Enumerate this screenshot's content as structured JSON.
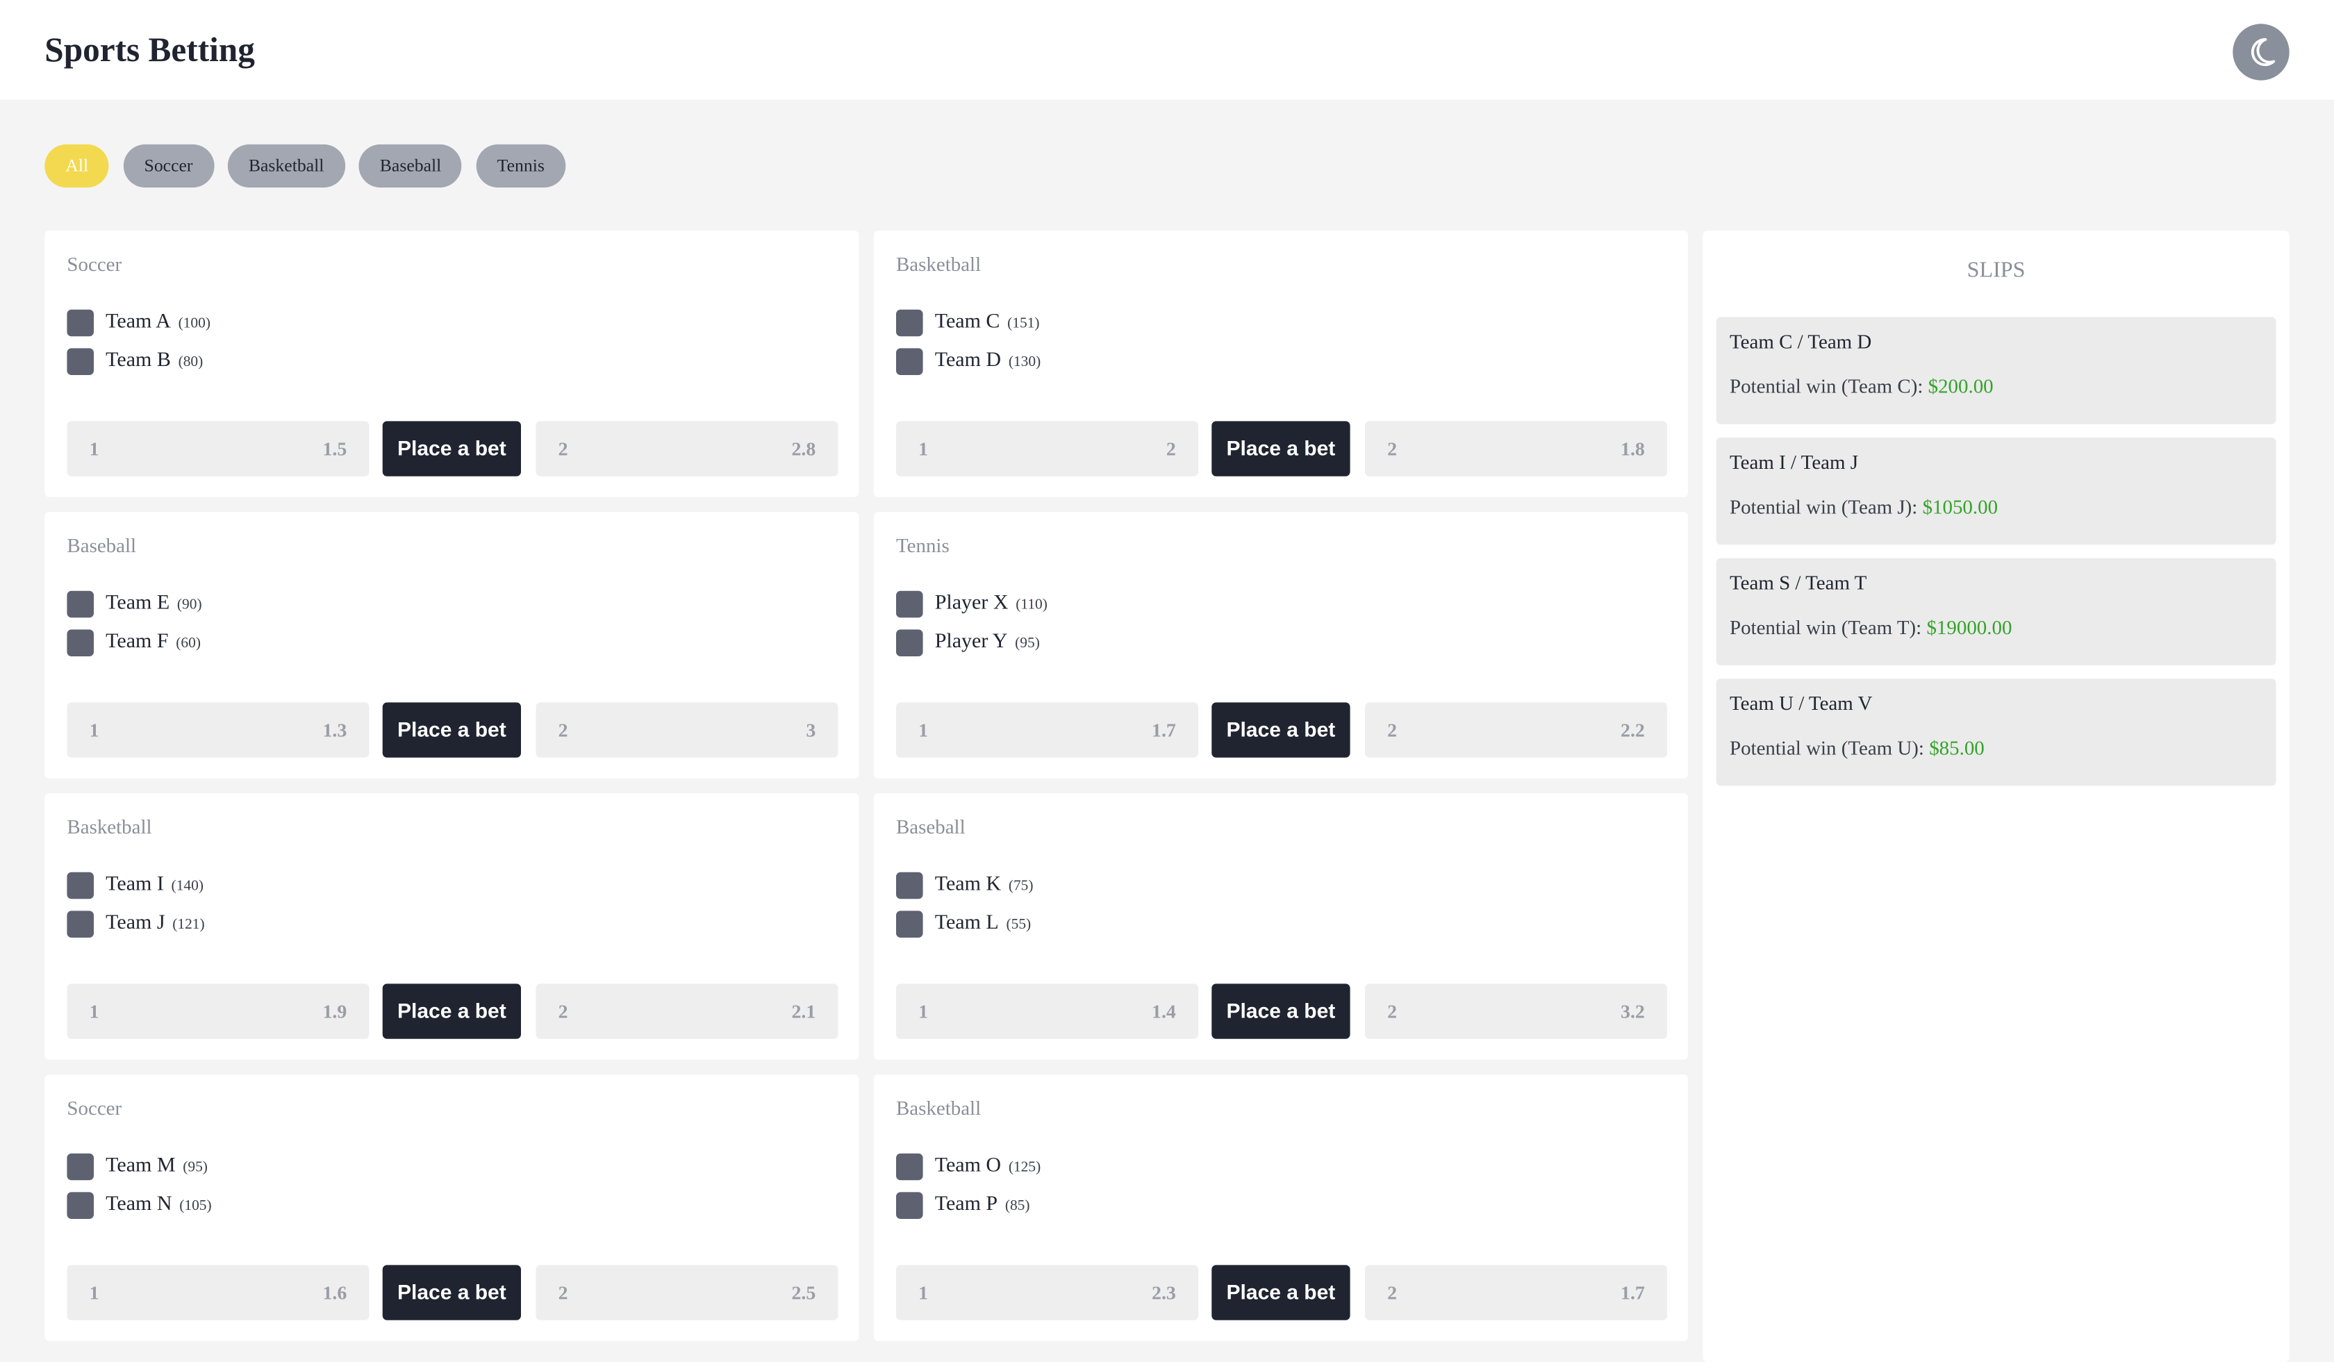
{
  "header": {
    "title": "Sports Betting",
    "theme_icon": "moon-icon"
  },
  "filters": [
    "All",
    "Soccer",
    "Basketball",
    "Baseball",
    "Tennis"
  ],
  "active_filter": "All",
  "matches": [
    {
      "sport": "Soccer",
      "team1": "Team A",
      "count1": "(100)",
      "team2": "Team B",
      "count2": "(80)",
      "odd1_key": "1",
      "odd1": "1.5",
      "odd2_key": "2",
      "odd2": "2.8",
      "bet_label": "Place a bet"
    },
    {
      "sport": "Basketball",
      "team1": "Team C",
      "count1": "(151)",
      "team2": "Team D",
      "count2": "(130)",
      "odd1_key": "1",
      "odd1": "2",
      "odd2_key": "2",
      "odd2": "1.8",
      "bet_label": "Place a bet"
    },
    {
      "sport": "Baseball",
      "team1": "Team E",
      "count1": "(90)",
      "team2": "Team F",
      "count2": "(60)",
      "odd1_key": "1",
      "odd1": "1.3",
      "odd2_key": "2",
      "odd2": "3",
      "bet_label": "Place a bet"
    },
    {
      "sport": "Tennis",
      "team1": "Player X",
      "count1": "(110)",
      "team2": "Player Y",
      "count2": "(95)",
      "odd1_key": "1",
      "odd1": "1.7",
      "odd2_key": "2",
      "odd2": "2.2",
      "bet_label": "Place a bet"
    },
    {
      "sport": "Basketball",
      "team1": "Team I",
      "count1": "(140)",
      "team2": "Team J",
      "count2": "(121)",
      "odd1_key": "1",
      "odd1": "1.9",
      "odd2_key": "2",
      "odd2": "2.1",
      "bet_label": "Place a bet"
    },
    {
      "sport": "Baseball",
      "team1": "Team K",
      "count1": "(75)",
      "team2": "Team L",
      "count2": "(55)",
      "odd1_key": "1",
      "odd1": "1.4",
      "odd2_key": "2",
      "odd2": "3.2",
      "bet_label": "Place a bet"
    },
    {
      "sport": "Soccer",
      "team1": "Team M",
      "count1": "(95)",
      "team2": "Team N",
      "count2": "(105)",
      "odd1_key": "1",
      "odd1": "1.6",
      "odd2_key": "2",
      "odd2": "2.5",
      "bet_label": "Place a bet"
    },
    {
      "sport": "Basketball",
      "team1": "Team O",
      "count1": "(125)",
      "team2": "Team P",
      "count2": "(85)",
      "odd1_key": "1",
      "odd1": "2.3",
      "odd2_key": "2",
      "odd2": "1.7",
      "bet_label": "Place a bet"
    }
  ],
  "slips": {
    "title": "SLIPS",
    "items": [
      {
        "match": "Team C / Team D",
        "win_label": "Potential win (Team C): ",
        "amount": "$200.00"
      },
      {
        "match": "Team I / Team J",
        "win_label": "Potential win (Team J): ",
        "amount": "$1050.00"
      },
      {
        "match": "Team S / Team T",
        "win_label": "Potential win (Team T): ",
        "amount": "$19000.00"
      },
      {
        "match": "Team U / Team V",
        "win_label": "Potential win (Team U): ",
        "amount": "$85.00"
      }
    ]
  },
  "colors": {
    "accent": "#f3d94f",
    "dark": "#1f2430",
    "win": "#34a32a",
    "chip": "#a3a7b1",
    "checkbox": "#5d6170"
  }
}
